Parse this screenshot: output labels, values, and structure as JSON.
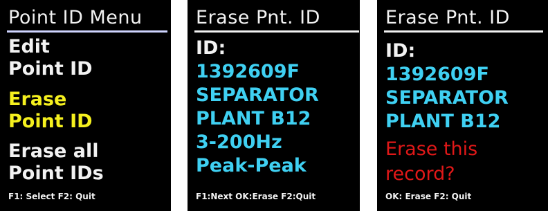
{
  "colors": {
    "white": "#f2f2f2",
    "yellow": "#f5f01e",
    "cyan": "#3fd0f2",
    "red": "#e01818",
    "underline_menu": "#cfd4ff"
  },
  "screen1": {
    "title": "Point ID Menu",
    "items": [
      {
        "line1": "Edit",
        "line2": "Point ID",
        "selected": false
      },
      {
        "line1": "Erase",
        "line2": "Point ID",
        "selected": true
      },
      {
        "line1": "Erase all",
        "line2": "Point IDs",
        "selected": false
      }
    ],
    "footer": "F1: Select  F2: Quit"
  },
  "screen2": {
    "title": "Erase Pnt. ID",
    "id_label": "ID:",
    "fields": [
      "1392609F",
      "SEPARATOR",
      "PLANT B12",
      "3-200Hz",
      "Peak-Peak"
    ],
    "footer": "F1:Next OK:Erase F2:Quit"
  },
  "screen3": {
    "title": "Erase Pnt. ID",
    "id_label": "ID:",
    "fields": [
      "1392609F",
      "SEPARATOR",
      "PLANT B12"
    ],
    "prompt_line1": "Erase this",
    "prompt_line2": "record?",
    "footer": "OK: Erase  F2: Quit"
  }
}
